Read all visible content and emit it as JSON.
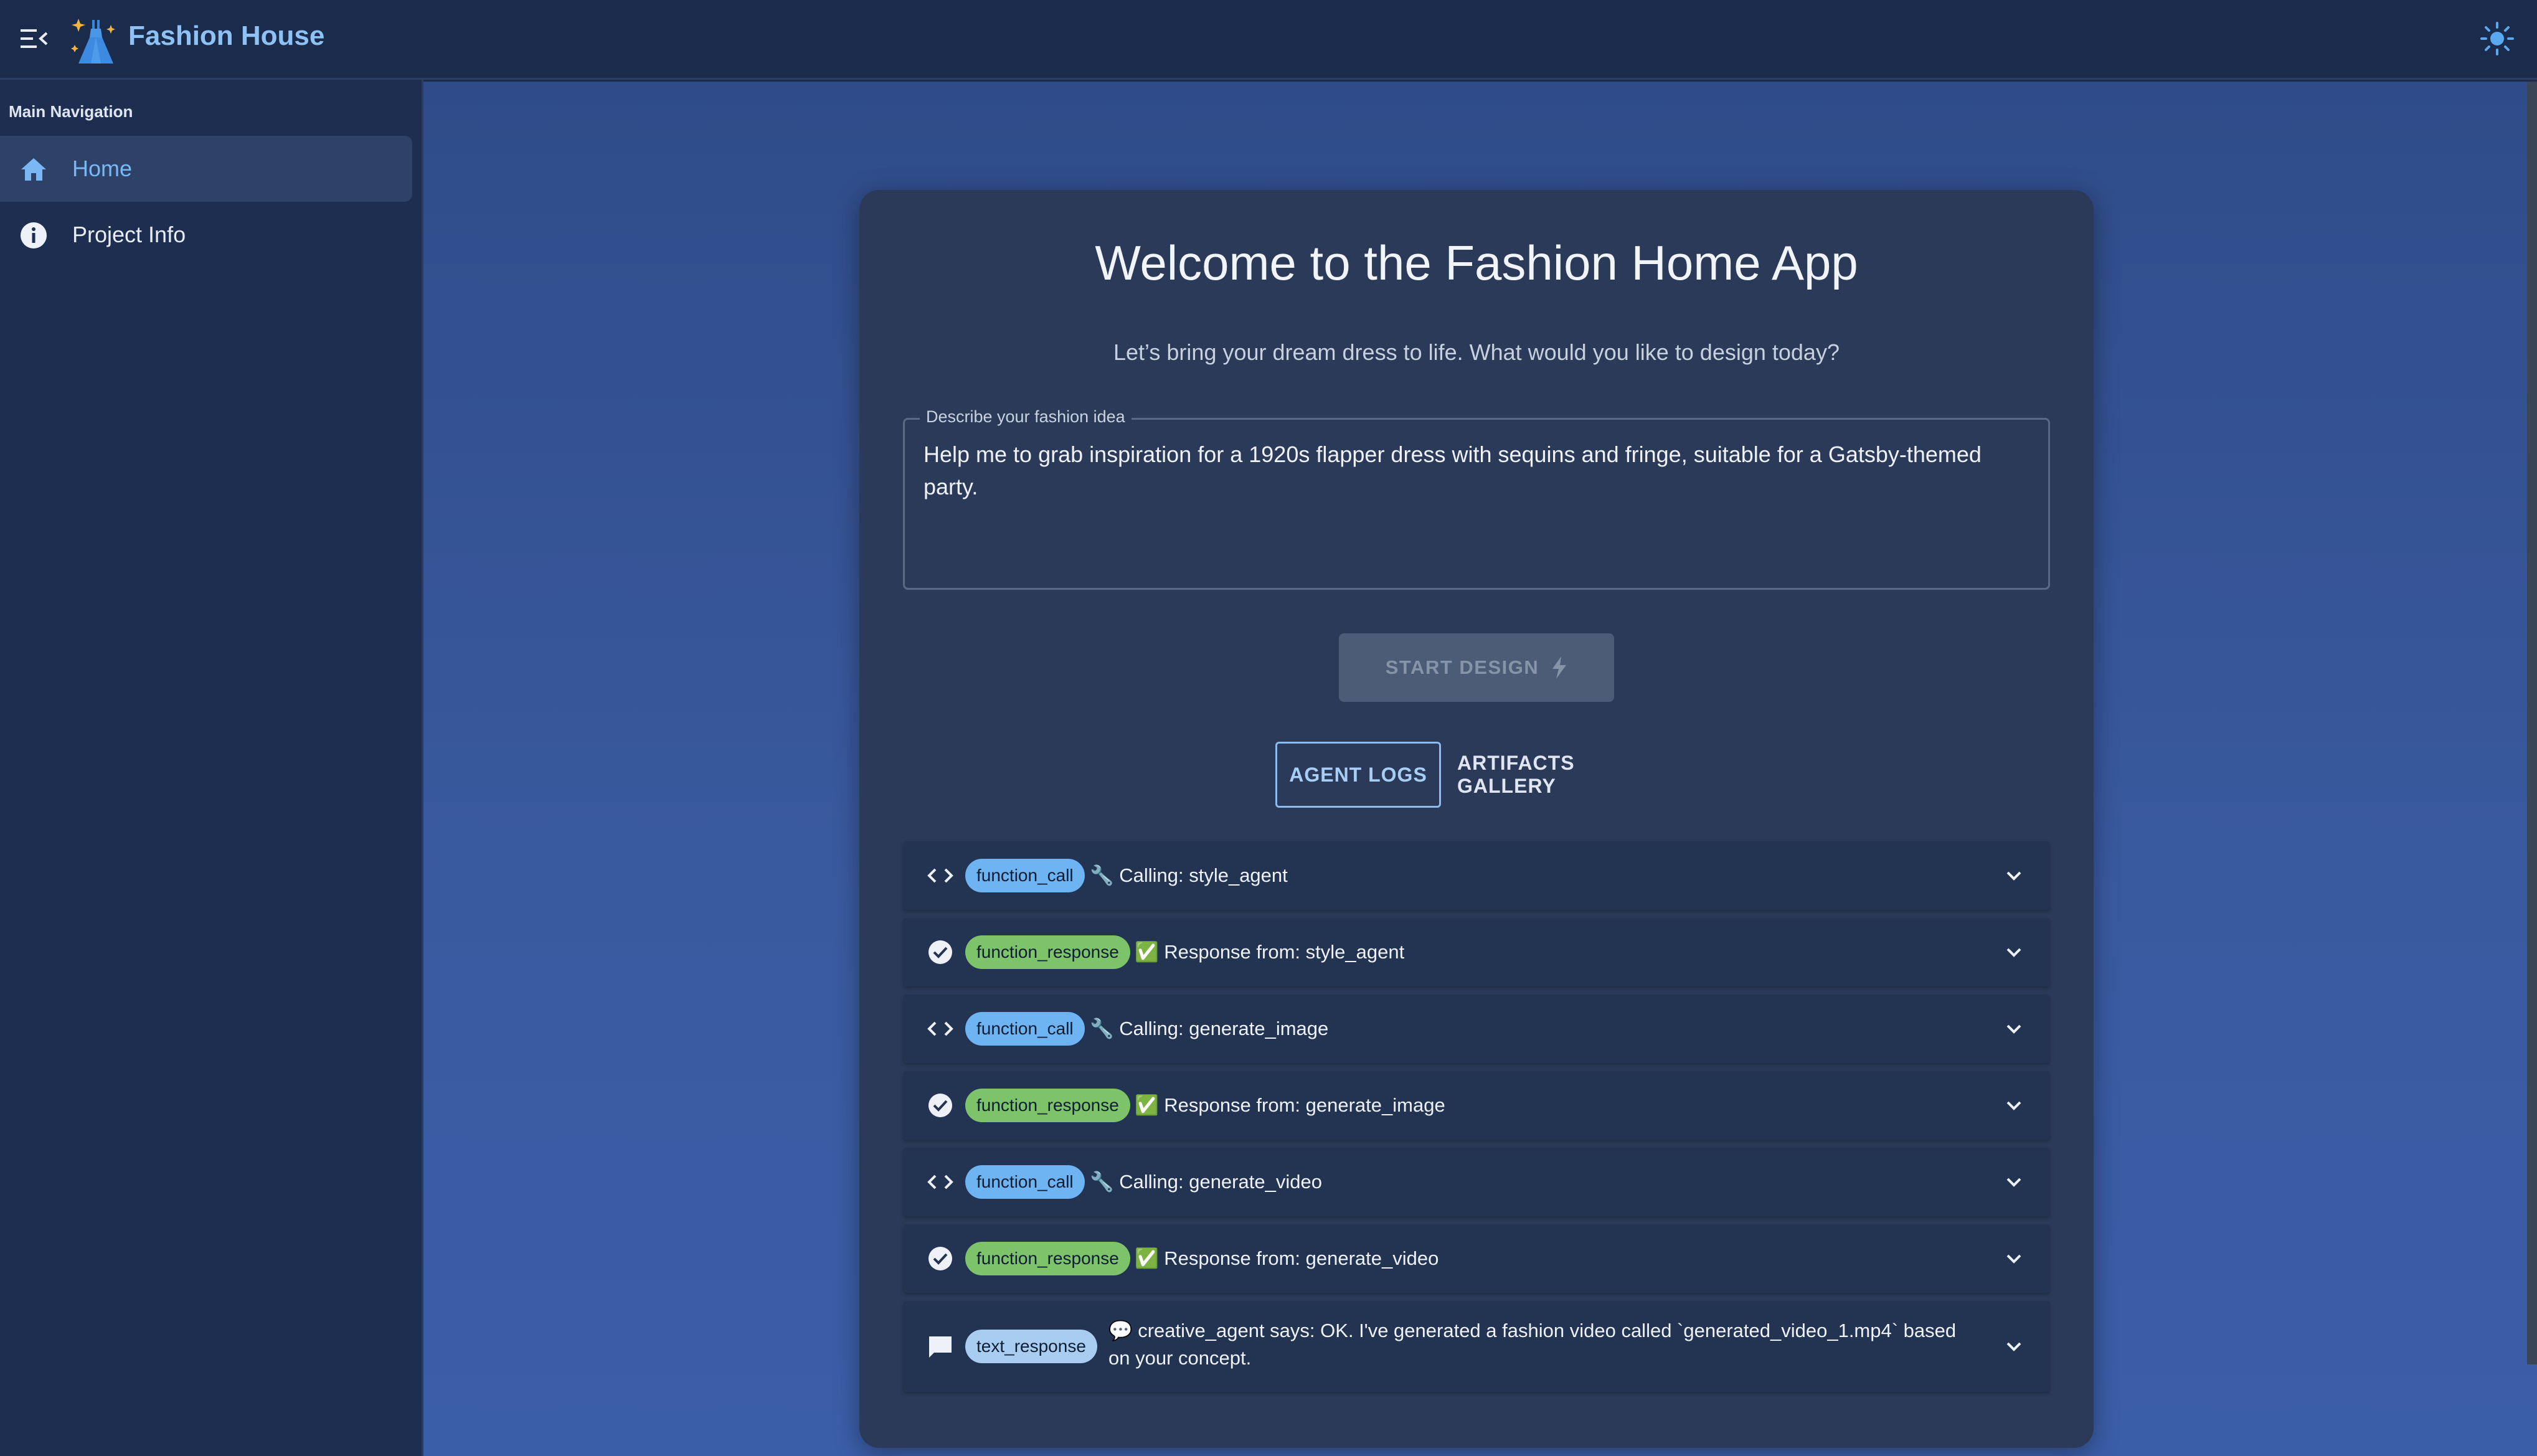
{
  "app": {
    "brand": "Fashion House"
  },
  "sidebar": {
    "heading": "Main Navigation",
    "items": [
      {
        "label": "Home",
        "icon": "home-icon",
        "active": true
      },
      {
        "label": "Project Info",
        "icon": "info-icon",
        "active": false
      }
    ]
  },
  "main": {
    "title": "Welcome to the Fashion Home App",
    "subtitle": "Let’s bring your dream dress to life. What would you like to design today?",
    "idea_field": {
      "label": "Describe your fashion idea",
      "value": "Help me to grab inspiration for a 1920s flapper dress with sequins and fringe, suitable for a Gatsby-themed party."
    },
    "start_button": "START DESIGN",
    "tabs": [
      {
        "label": "AGENT LOGS",
        "active": true
      },
      {
        "label": "ARTIFACTS GALLERY",
        "active": false
      }
    ],
    "logs": [
      {
        "type": "function_call",
        "icon": "code-icon",
        "text": "🔧 Calling: style_agent"
      },
      {
        "type": "function_response",
        "icon": "check-circle-icon",
        "text": "✅ Response from: style_agent"
      },
      {
        "type": "function_call",
        "icon": "code-icon",
        "text": "🔧 Calling: generate_image"
      },
      {
        "type": "function_response",
        "icon": "check-circle-icon",
        "text": "✅ Response from: generate_image"
      },
      {
        "type": "function_call",
        "icon": "code-icon",
        "text": "🔧 Calling: generate_video"
      },
      {
        "type": "function_response",
        "icon": "check-circle-icon",
        "text": "✅ Response from: generate_video"
      },
      {
        "type": "text_response",
        "icon": "chat-icon",
        "text": "💬 creative_agent says: OK. I've generated a fashion video called `generated_video_1.mp4` based on your concept."
      }
    ]
  },
  "colors": {
    "accent": "#7ab8f5",
    "call_badge": "#6eb3f2",
    "response_badge": "#7cc36a",
    "text_badge": "#a9cdf1"
  }
}
